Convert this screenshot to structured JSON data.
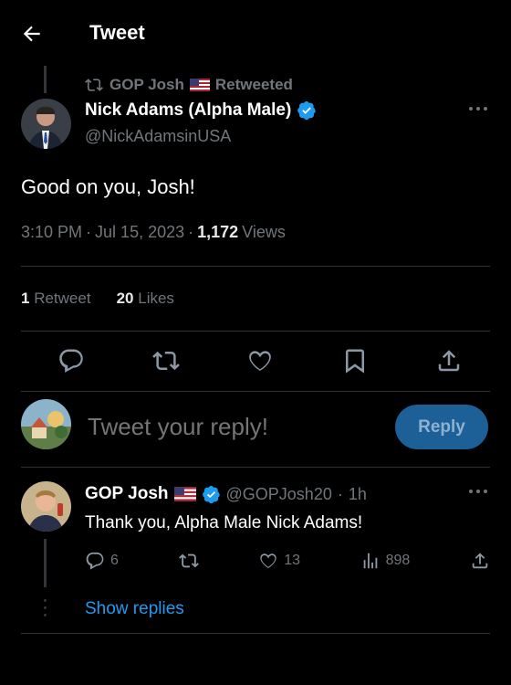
{
  "header": {
    "title": "Tweet"
  },
  "retweet": {
    "by": "GOP Josh",
    "label": "Retweeted"
  },
  "tweet": {
    "name": "Nick Adams (Alpha Male)",
    "handle": "@NickAdamsinUSA",
    "text": "Good on you, Josh!",
    "time": "3:10 PM",
    "date": "Jul 15, 2023",
    "views_count": "1,172",
    "views_label": "Views",
    "retweets_count": "1",
    "retweets_label": "Retweet",
    "likes_count": "20",
    "likes_label": "Likes"
  },
  "composer": {
    "placeholder": "Tweet your reply!",
    "button": "Reply"
  },
  "reply": {
    "name": "GOP Josh",
    "handle": "@GOPJosh20",
    "age": "1h",
    "text": "Thank you, Alpha Male Nick Adams!",
    "replies": "6",
    "likes": "13",
    "views": "898"
  },
  "show_replies": "Show replies",
  "colors": {
    "accent": "#1d9bf0",
    "verified": "#1d9bf0",
    "reply_button": "#1d5f97"
  }
}
